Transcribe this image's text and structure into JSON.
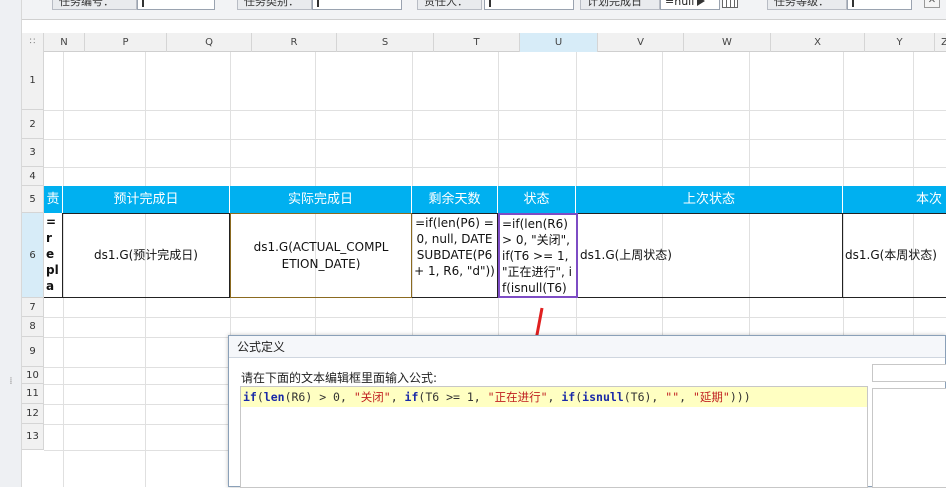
{
  "param_bar": {
    "fields": [
      {
        "label": "任务编号："
      },
      {
        "label": "任务类别："
      },
      {
        "label": "责任人："
      },
      {
        "label": "计划完成日"
      },
      {
        "label": "任务等级："
      }
    ],
    "date_value": "=null"
  },
  "columns": [
    "N",
    "P",
    "Q",
    "R",
    "S",
    "T",
    "U",
    "V",
    "W",
    "X",
    "Y",
    "Z"
  ],
  "rows": [
    "1",
    "2",
    "3",
    "4",
    "5",
    "6",
    "7",
    "8",
    "9",
    "10",
    "11",
    "12",
    "13"
  ],
  "header_row": {
    "c_n": "责",
    "c_p": "预计完成日",
    "c_r": "实际完成日",
    "c_t": "剩余天数",
    "c_u": "状态",
    "c_v": "上次状态",
    "c_y": "本次"
  },
  "data_row": {
    "c_n": "=replace(",
    "c_p": "ds1.G(预计完成日)",
    "c_r": "ds1.G(ACTUAL_COMPLETION_DATE)",
    "c_t": "=if(len(P6) = 0, null, DATESUBDATE(P6 + 1, R6, \"d\"))",
    "c_u": "=if(len(R6) > 0, \"关闭\", if(T6 >= 1, \"正在进行\", if(isnull(T6)",
    "c_v": "ds1.G(上周状态)",
    "c_y": "ds1.G(本周状态)"
  },
  "dialog": {
    "title": "公式定义",
    "instruction": "请在下面的文本编辑框里面输入公式:",
    "formula": "if(len(R6) > 0, \"关闭\", if(T6 >= 1, \"正在进行\", if(isnull(T6), \"\", \"延期\")))"
  },
  "colors": {
    "header_bg": "#00b0f0",
    "selection": "#d7ecf8",
    "arrow": "#e02020"
  }
}
